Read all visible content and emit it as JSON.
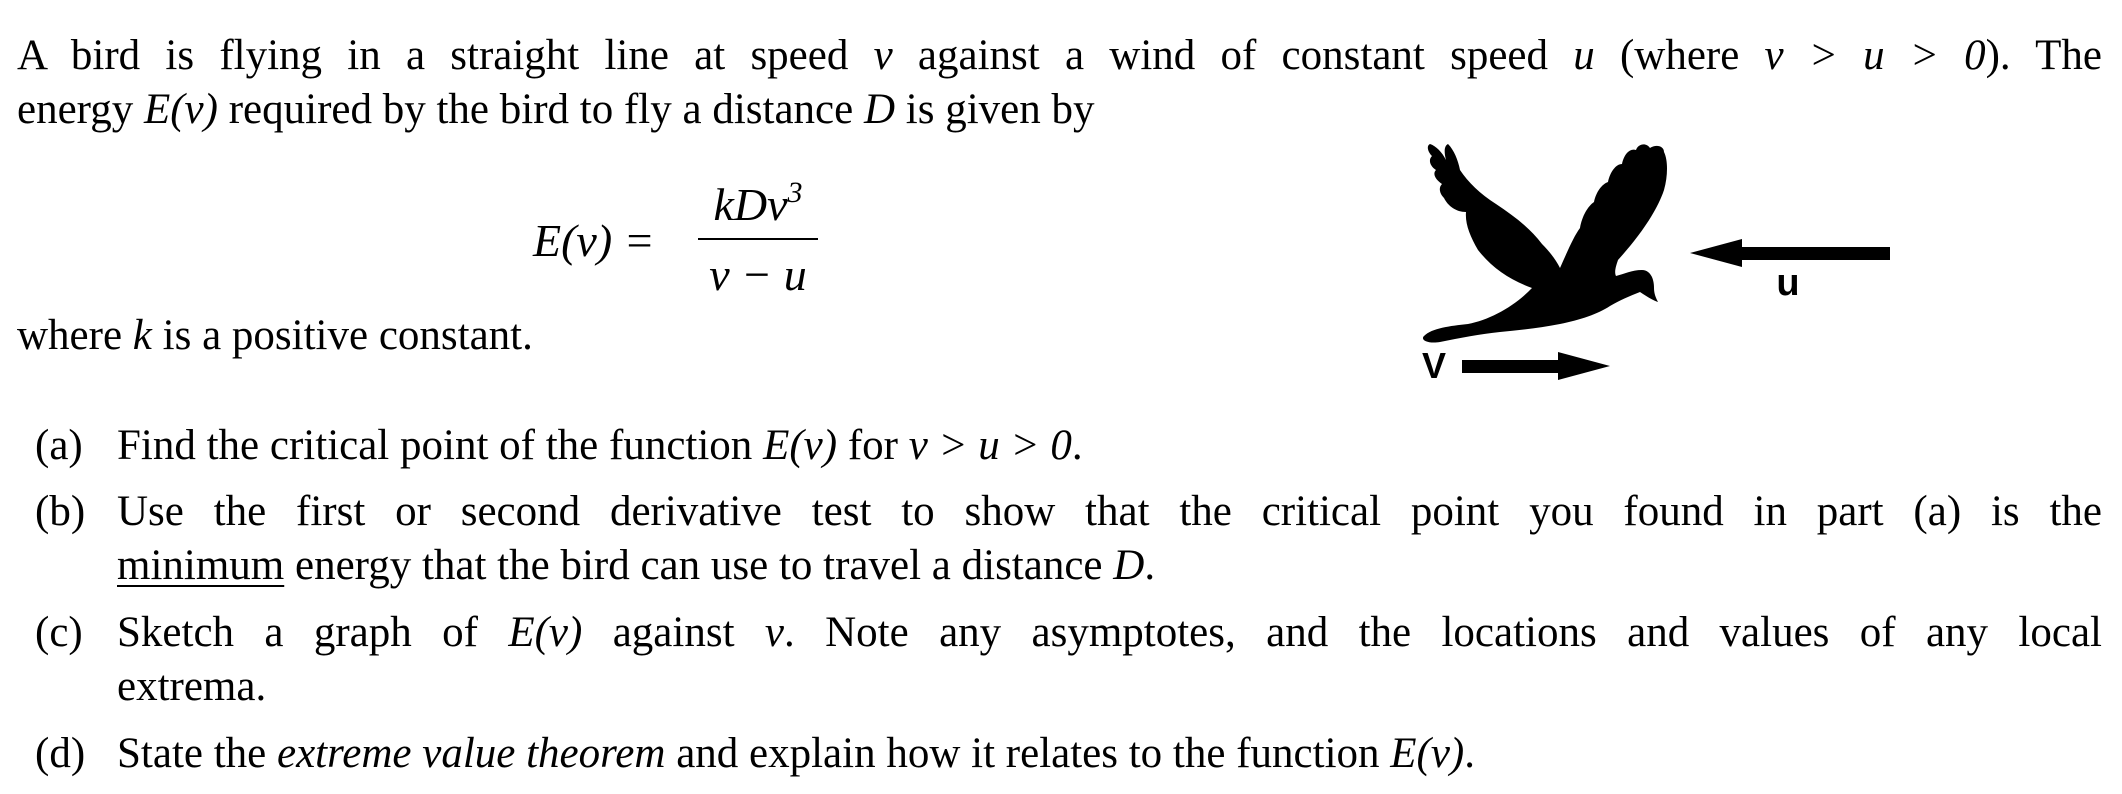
{
  "intro": {
    "line1_a": "A bird is flying in a straight line at speed ",
    "v": "v",
    "line1_b": " against a wind of constant speed ",
    "u": "u",
    "line1_c": " (where ",
    "cond": "v > u > 0",
    "line1_d": ").  The",
    "line2_a": "energy ",
    "Ev": "E(v)",
    "line2_b": " required by the bird to fly a distance ",
    "D": "D",
    "line2_c": " is given by"
  },
  "formula": {
    "lhs": "E(v) =",
    "numerator": "kDv",
    "numerator_exp": "3",
    "denominator": "v − u"
  },
  "where": {
    "a": "where ",
    "k": "k",
    "b": " is a positive constant."
  },
  "figure": {
    "wind_label": "u",
    "velocity_label": "V"
  },
  "questions": [
    {
      "label": "(a)",
      "a": "Find the critical point of the function ",
      "Ev": "E(v)",
      "b": " for ",
      "cond": "v > u > 0",
      "c": "."
    },
    {
      "label": "(b)",
      "line1": "Use the first or second derivative test to show that the critical point you found in part (a) is the",
      "underlined": "minimum",
      "line2_a": " energy that the bird can use to travel a distance ",
      "D": "D",
      "line2_b": "."
    },
    {
      "label": "(c)",
      "a": "Sketch a graph of ",
      "Ev": "E(v)",
      "b": " against ",
      "v": "v",
      "c": ".  Note any asymptotes, and the locations and values of any local",
      "line2": "extrema."
    },
    {
      "label": "(d)",
      "a": "State the ",
      "emph": "extreme value theorem",
      "b": " and explain how it relates to the function ",
      "Ev": "E(v)",
      "c": "."
    }
  ]
}
